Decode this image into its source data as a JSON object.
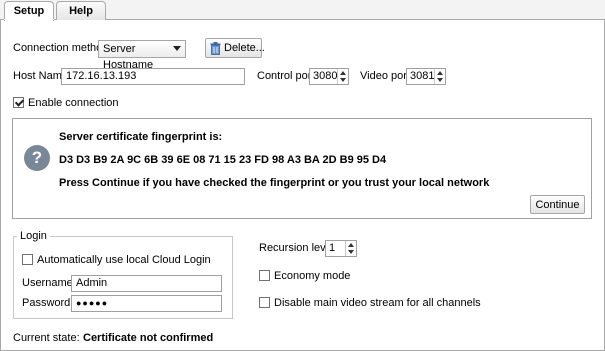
{
  "tabs": [
    {
      "label": "Setup",
      "active": true
    },
    {
      "label": "Help",
      "active": false
    }
  ],
  "connection": {
    "method_label": "Connection method:",
    "method_value": "Server Hostname",
    "delete_label": "Delete..."
  },
  "host": {
    "name_label": "Host Name:",
    "name_value": "172.16.13.193",
    "control_port_label": "Control port:",
    "control_port_value": "3080",
    "video_port_label": "Video port:",
    "video_port_value": "3081"
  },
  "enable": {
    "label": "Enable connection",
    "checked": true
  },
  "certificate": {
    "title": "Server certificate fingerprint is:",
    "fingerprint": "D3 D3 B9 2A 9C 6B 39 6E 08 71 15 23 FD 98 A3 BA 2D B9 95 D4",
    "message": "Press Continue if you have checked the fingerprint or you trust your local network",
    "continue_label": "Continue",
    "icon": "question-icon"
  },
  "login": {
    "group_title": "Login",
    "auto_label": "Automatically use local Cloud Login",
    "auto_checked": false,
    "username_label": "Username:",
    "username_value": "Admin",
    "password_label": "Password:",
    "password_value": "●●●●●"
  },
  "options": {
    "recursion_label": "Recursion level:",
    "recursion_value": "1",
    "economy_label": "Economy mode",
    "economy_checked": false,
    "disable_video_label": "Disable main video stream for all channels",
    "disable_video_checked": false
  },
  "state": {
    "label": "Current state:",
    "value": "Certificate not confirmed"
  },
  "colors": {
    "border": "#a0a0a0",
    "icon_bg": "#7a8798"
  }
}
